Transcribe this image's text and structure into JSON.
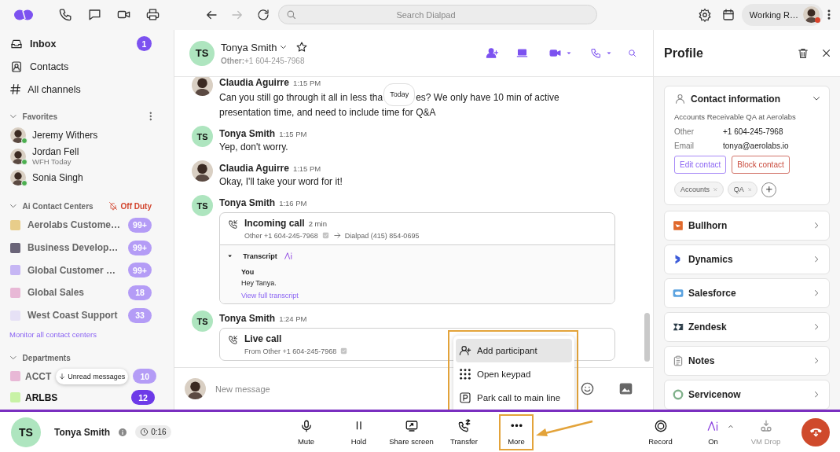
{
  "toolbar": {
    "forward_disabled": true,
    "search": {
      "placeholder": "Search Dialpad"
    },
    "status": "Working R…"
  },
  "sidebar": {
    "nav": [
      {
        "label": "Inbox",
        "count": "1",
        "unread": true
      },
      {
        "label": "Contacts",
        "unread": false
      },
      {
        "label": "All channels",
        "unread": false
      }
    ],
    "favorites": {
      "title": "Favorites",
      "expanded": true,
      "contacts": [
        {
          "name": "Jeremy Withers",
          "online": true
        },
        {
          "name": "Jordan Fell",
          "status": "WFH Today",
          "online": true
        },
        {
          "name": "Sonia Singh",
          "online": true
        }
      ]
    },
    "contact_centers": {
      "title": "Ai Contact Centers",
      "expanded": true,
      "duty": "Off Duty",
      "items": [
        {
          "name": "Aerolabs Custome…",
          "color": "#e8cd8a",
          "count": "99+"
        },
        {
          "name": "Business Develop…",
          "color": "#6a6478",
          "count": "99+"
        },
        {
          "name": "Global Customer …",
          "color": "#c6b6f4",
          "count": "99+"
        },
        {
          "name": "Global Sales",
          "color": "#e8b8d6",
          "count": "18"
        },
        {
          "name": "West Coast Support",
          "color": "#e6e1f6",
          "count": "33"
        }
      ],
      "link": "Monitor all contact centers"
    },
    "departments": {
      "title": "Departments",
      "expanded": true,
      "items": [
        {
          "name": "ACCT",
          "color": "#e8b8d6",
          "count": "10",
          "unread": false
        },
        {
          "name": "ARLBS",
          "color": "#c8f2a6",
          "count": "12",
          "unread": true
        }
      ]
    },
    "unread_button": "Unread messages"
  },
  "chat": {
    "contact": {
      "initials": "TS",
      "name": "Tonya Smith",
      "subtitle": "**Other:**+1 604-245-7968"
    },
    "date_pill": "Today",
    "messages": [
      {
        "kind": "text",
        "author": "Claudia Aguirre",
        "time": "1:15 PM",
        "text": "Can you still go through it all in less tha",
        "text_after": "es? We only have 10 min of active",
        "text_next": "presentation time, and need to include time for Q&A"
      },
      {
        "kind": "text",
        "initials": "TS",
        "author": "Tonya Smith",
        "time": "1:15 PM",
        "text": "Yep, don't worry."
      },
      {
        "kind": "text",
        "author": "Claudia Aguirre",
        "time": "1:15 PM",
        "text": "Okay, I'll take your word for it!"
      },
      {
        "kind": "call",
        "initials": "TS",
        "author": "Tonya Smith",
        "time": "1:16 PM",
        "call": {
          "title": "Incoming call",
          "duration": "2 min",
          "from": "Other +1 604-245-7968",
          "to": "Dialpad (415) 854-0695",
          "transcript": {
            "title": "Transcript",
            "expanded": true,
            "speaker": "You",
            "text": "Hey Tanya.",
            "link": "View full transcript"
          }
        }
      },
      {
        "kind": "call",
        "initials": "TS",
        "author": "Tonya Smith",
        "time": "1:24 PM",
        "call": {
          "title": "Live call",
          "from": "From Other +1 604-245-7968"
        }
      }
    ],
    "composer": {
      "placeholder": "New message"
    },
    "menu": [
      {
        "label": "Add participant",
        "selected": true
      },
      {
        "label": "Open keypad",
        "selected": false
      },
      {
        "label": "Park call to main line",
        "selected": false
      }
    ]
  },
  "profile": {
    "title": "Profile",
    "contact_info": {
      "title": "Contact information",
      "expanded": true,
      "company": "Accounts Receivable QA at Aerolabs",
      "fields": [
        {
          "label": "Other",
          "value": "+1 604-245-7968"
        },
        {
          "label": "Email",
          "value": "tonya@aerolabs.io"
        }
      ],
      "buttons": [
        {
          "label": "Edit contact",
          "kind": "edit"
        },
        {
          "label": "Block contact",
          "kind": "block"
        }
      ],
      "tags": [
        "Accounts",
        "QA"
      ]
    },
    "integrations": [
      {
        "name": "Bullhorn",
        "kind": "bullhorn"
      },
      {
        "name": "Dynamics",
        "kind": "dynamics"
      },
      {
        "name": "Salesforce",
        "kind": "salesforce"
      },
      {
        "name": "Zendesk",
        "kind": "zendesk"
      },
      {
        "name": "Notes",
        "kind": "notes"
      },
      {
        "name": "Servicenow",
        "kind": "servicenow"
      }
    ]
  },
  "call_bar": {
    "initials": "TS",
    "name": "Tonya Smith",
    "timer": "0:16",
    "controls": [
      {
        "label": "Mute",
        "highlighted": false
      },
      {
        "label": "Hold",
        "highlighted": false
      },
      {
        "label": "Share screen",
        "highlighted": false
      },
      {
        "label": "Transfer",
        "highlighted": false
      },
      {
        "label": "More",
        "highlighted": true
      }
    ],
    "tools": [
      {
        "label": "Record",
        "disabled": false
      },
      {
        "label": "On",
        "disabled": false
      },
      {
        "label": "VM Drop",
        "disabled": true
      }
    ]
  }
}
